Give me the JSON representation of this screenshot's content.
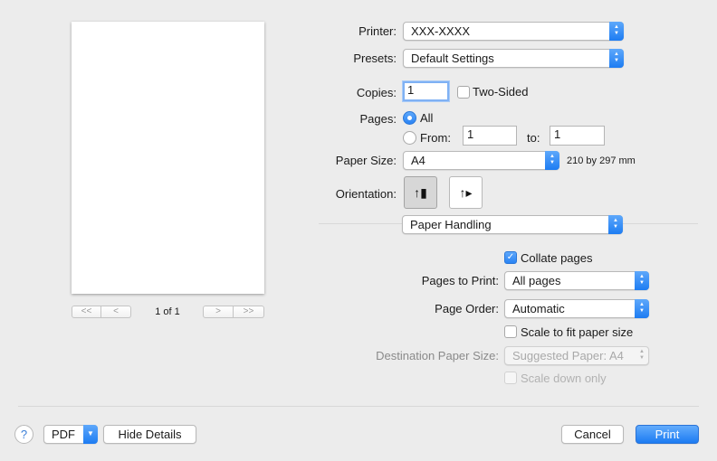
{
  "preview": {
    "first_label": "<<",
    "prev_label": "<",
    "page_info": "1 of 1",
    "next_label": ">",
    "last_label": ">>"
  },
  "printer": {
    "label": "Printer:",
    "value": "XXX-XXXX"
  },
  "presets": {
    "label": "Presets:",
    "value": "Default Settings"
  },
  "copies": {
    "label": "Copies:",
    "value": "1",
    "two_sided_label": "Two-Sided",
    "two_sided_checked": false
  },
  "pages": {
    "label": "Pages:",
    "all_label": "All",
    "from_label": "From:",
    "from_value": "1",
    "to_label": "to:",
    "to_value": "1",
    "selected": "All"
  },
  "paper_size": {
    "label": "Paper Size:",
    "value": "A4",
    "dimensions": "210 by 297 mm"
  },
  "orientation": {
    "label": "Orientation:",
    "selected": "portrait"
  },
  "section": {
    "value": "Paper Handling"
  },
  "paper_handling": {
    "collate_label": "Collate pages",
    "collate_checked": true,
    "pages_to_print_label": "Pages to Print:",
    "pages_to_print_value": "All pages",
    "page_order_label": "Page Order:",
    "page_order_value": "Automatic",
    "scale_fit_label": "Scale to fit paper size",
    "scale_fit_checked": false,
    "destination_label": "Destination Paper Size:",
    "destination_value": "Suggested Paper: A4",
    "scale_down_label": "Scale down only",
    "scale_down_checked": false
  },
  "footer": {
    "help_label": "?",
    "pdf_label": "PDF",
    "hide_details_label": "Hide Details",
    "cancel_label": "Cancel",
    "print_label": "Print"
  },
  "colors": {
    "accent": "#1d7cf2",
    "background": "#ececec"
  },
  "icons": {
    "select_arrows": "updown-chevrons-icon",
    "checkmark": "checkmark-icon",
    "portrait": "portrait-orientation-icon",
    "landscape": "landscape-orientation-icon",
    "help": "help-icon"
  }
}
